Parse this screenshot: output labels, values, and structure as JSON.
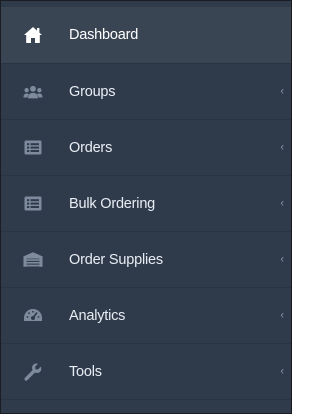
{
  "sidebar": {
    "items": [
      {
        "label": "Dashboard",
        "icon": "home-icon",
        "active": true,
        "has_chevron": false
      },
      {
        "label": "Groups",
        "icon": "users-icon",
        "active": false,
        "has_chevron": true
      },
      {
        "label": "Orders",
        "icon": "list-icon",
        "active": false,
        "has_chevron": true
      },
      {
        "label": "Bulk Ordering",
        "icon": "list-icon",
        "active": false,
        "has_chevron": true
      },
      {
        "label": "Order Supplies",
        "icon": "warehouse-icon",
        "active": false,
        "has_chevron": true
      },
      {
        "label": "Analytics",
        "icon": "gauge-icon",
        "active": false,
        "has_chevron": true
      },
      {
        "label": "Tools",
        "icon": "wrench-icon",
        "active": false,
        "has_chevron": true
      }
    ],
    "chevron_glyph": "‹"
  },
  "colors": {
    "background": "#2f3b4b",
    "active_background": "#3a4554",
    "text": "#ffffff",
    "icon": "#7e8b9d"
  }
}
